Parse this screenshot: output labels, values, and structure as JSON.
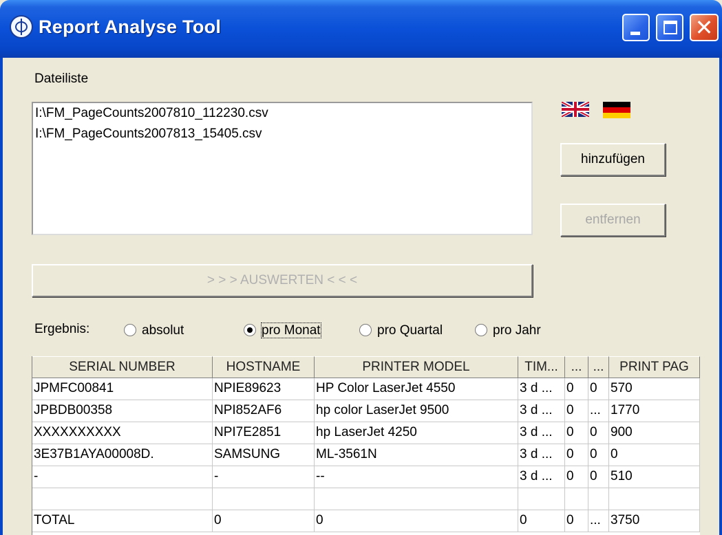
{
  "window": {
    "title": "Report Analyse Tool"
  },
  "files": {
    "label": "Dateiliste",
    "items": [
      "I:\\FM_PageCounts2007810_112230.csv",
      "I:\\FM_PageCounts2007813_15405.csv"
    ]
  },
  "buttons": {
    "add": "hinzufügen",
    "remove": "entfernen",
    "evaluate": "> > > AUSWERTEN < < <"
  },
  "result": {
    "label": "Ergebnis:",
    "options": [
      "absolut",
      "pro Monat",
      "pro Quartal",
      "pro Jahr"
    ],
    "selected": "pro Monat"
  },
  "table": {
    "columns": [
      "SERIAL NUMBER",
      "HOSTNAME",
      "PRINTER MODEL",
      "TIM...",
      "...",
      "...",
      "PRINT PAG"
    ],
    "rows": [
      [
        "JPMFC00841",
        "NPIE89623",
        "HP Color LaserJet 4550",
        "3 d ...",
        "0",
        "0",
        "570"
      ],
      [
        "JPBDB00358",
        "NPI852AF6",
        "hp color LaserJet 9500",
        "3 d ...",
        "0",
        "...",
        "1770"
      ],
      [
        "XXXXXXXXXX",
        "NPI7E2851",
        "hp LaserJet 4250",
        "3 d ...",
        "0",
        "0",
        "900"
      ],
      [
        "3E37B1AYA00008D.",
        "SAMSUNG",
        "ML-3561N",
        "3 d ...",
        "0",
        "0",
        "0"
      ],
      [
        "-",
        "-",
        "--",
        "3 d ...",
        "0",
        "0",
        "510"
      ],
      [
        "",
        "",
        "",
        "",
        "",
        "",
        ""
      ],
      [
        "TOTAL",
        "0",
        "0",
        "0",
        "0",
        "...",
        "3750"
      ]
    ]
  },
  "colors": {
    "titlebar": "#0a50d8",
    "face": "#ece9d8",
    "close": "#e0502a"
  }
}
